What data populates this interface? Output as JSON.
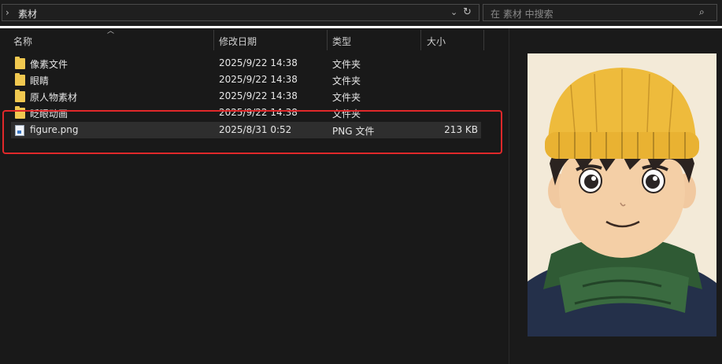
{
  "address": {
    "chevron": "›",
    "path": "素材",
    "dropdown": "⌄",
    "refresh": "↻"
  },
  "search": {
    "placeholder": "在 素材 中搜索",
    "icon": "⌕"
  },
  "columns": {
    "name": "名称",
    "date": "修改日期",
    "type": "类型",
    "size": "大小"
  },
  "files": [
    {
      "name": "像素文件",
      "date": "2025/9/22 14:38",
      "type": "文件夹",
      "size": ""
    },
    {
      "name": "眼睛",
      "date": "2025/9/22 14:38",
      "type": "文件夹",
      "size": ""
    },
    {
      "name": "原人物素材",
      "date": "2025/9/22 14:38",
      "type": "文件夹",
      "size": ""
    },
    {
      "name": "眨眼动画",
      "date": "2025/9/22 14:38",
      "type": "文件夹",
      "size": ""
    },
    {
      "name": "figure.png",
      "date": "2025/8/31 0:52",
      "type": "PNG 文件",
      "size": "213 KB"
    }
  ],
  "colors": {
    "highlight": "#e0282a",
    "folder": "#f0c850",
    "background": "#191919"
  }
}
